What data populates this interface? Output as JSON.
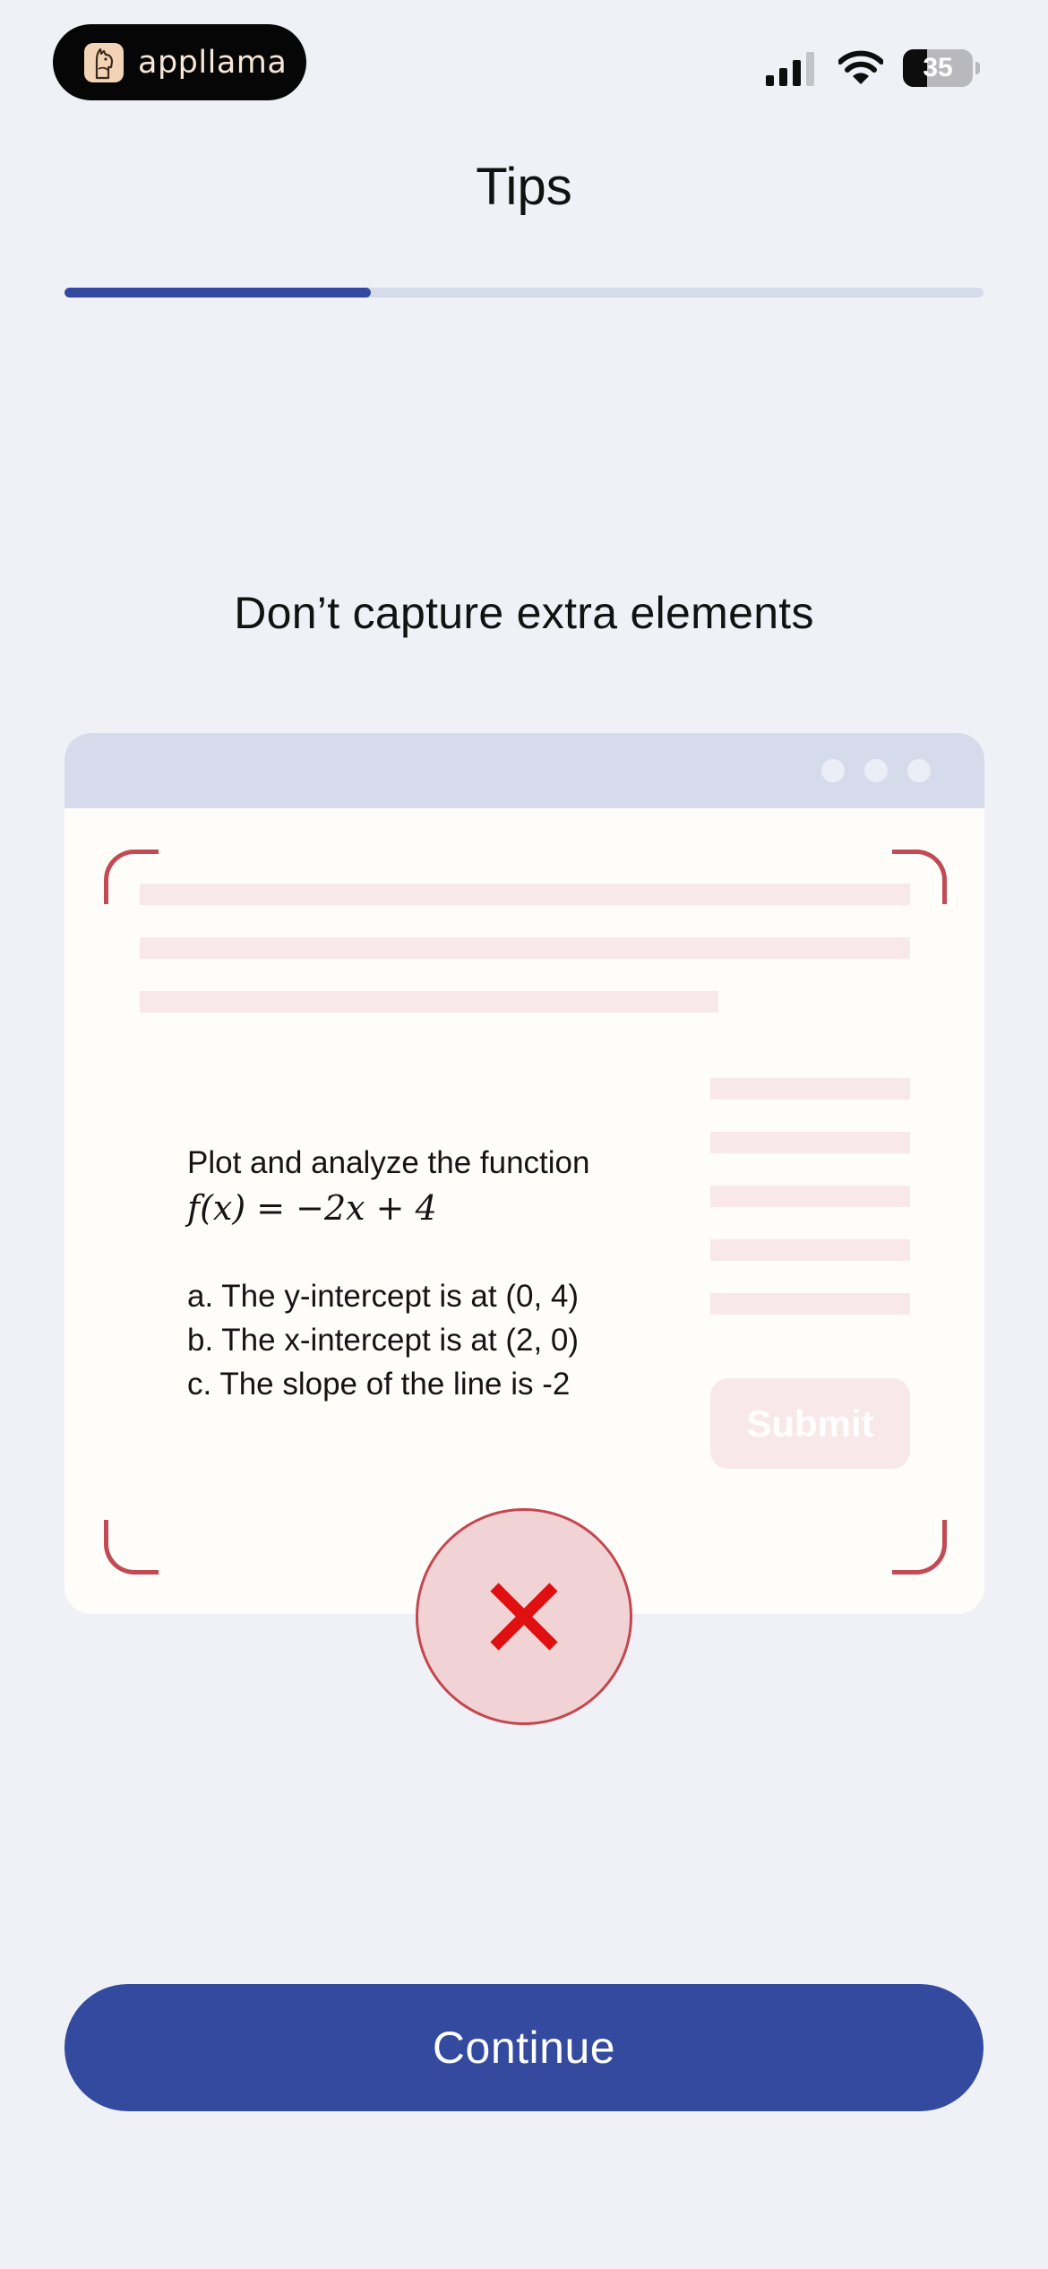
{
  "status_bar": {
    "brand_name": "appllama",
    "battery_level": "35",
    "battery_fraction": 0.35
  },
  "header": {
    "title": "Tips",
    "progress_fraction": 0.333
  },
  "tip": {
    "heading": "Don’t capture extra elements"
  },
  "illustration": {
    "problem_prompt": "Plot and analyze the function",
    "formula": "f(x) = −2x + 4",
    "statements": [
      "a. The y-intercept is at (0, 4)",
      "b. The x-intercept is at (2, 0)",
      "c. The slope of the line is -2"
    ],
    "submit_label": "Submit"
  },
  "footer": {
    "continue_label": "Continue"
  },
  "colors": {
    "accent": "#344a9f",
    "error": "#e01010",
    "frame": "#c24a55",
    "background": "#eff1f7"
  },
  "icons": {
    "brand": "llama-logo-icon",
    "signal": "cellular-signal-icon",
    "wifi": "wifi-icon",
    "battery": "battery-icon",
    "error": "close-x-icon"
  }
}
